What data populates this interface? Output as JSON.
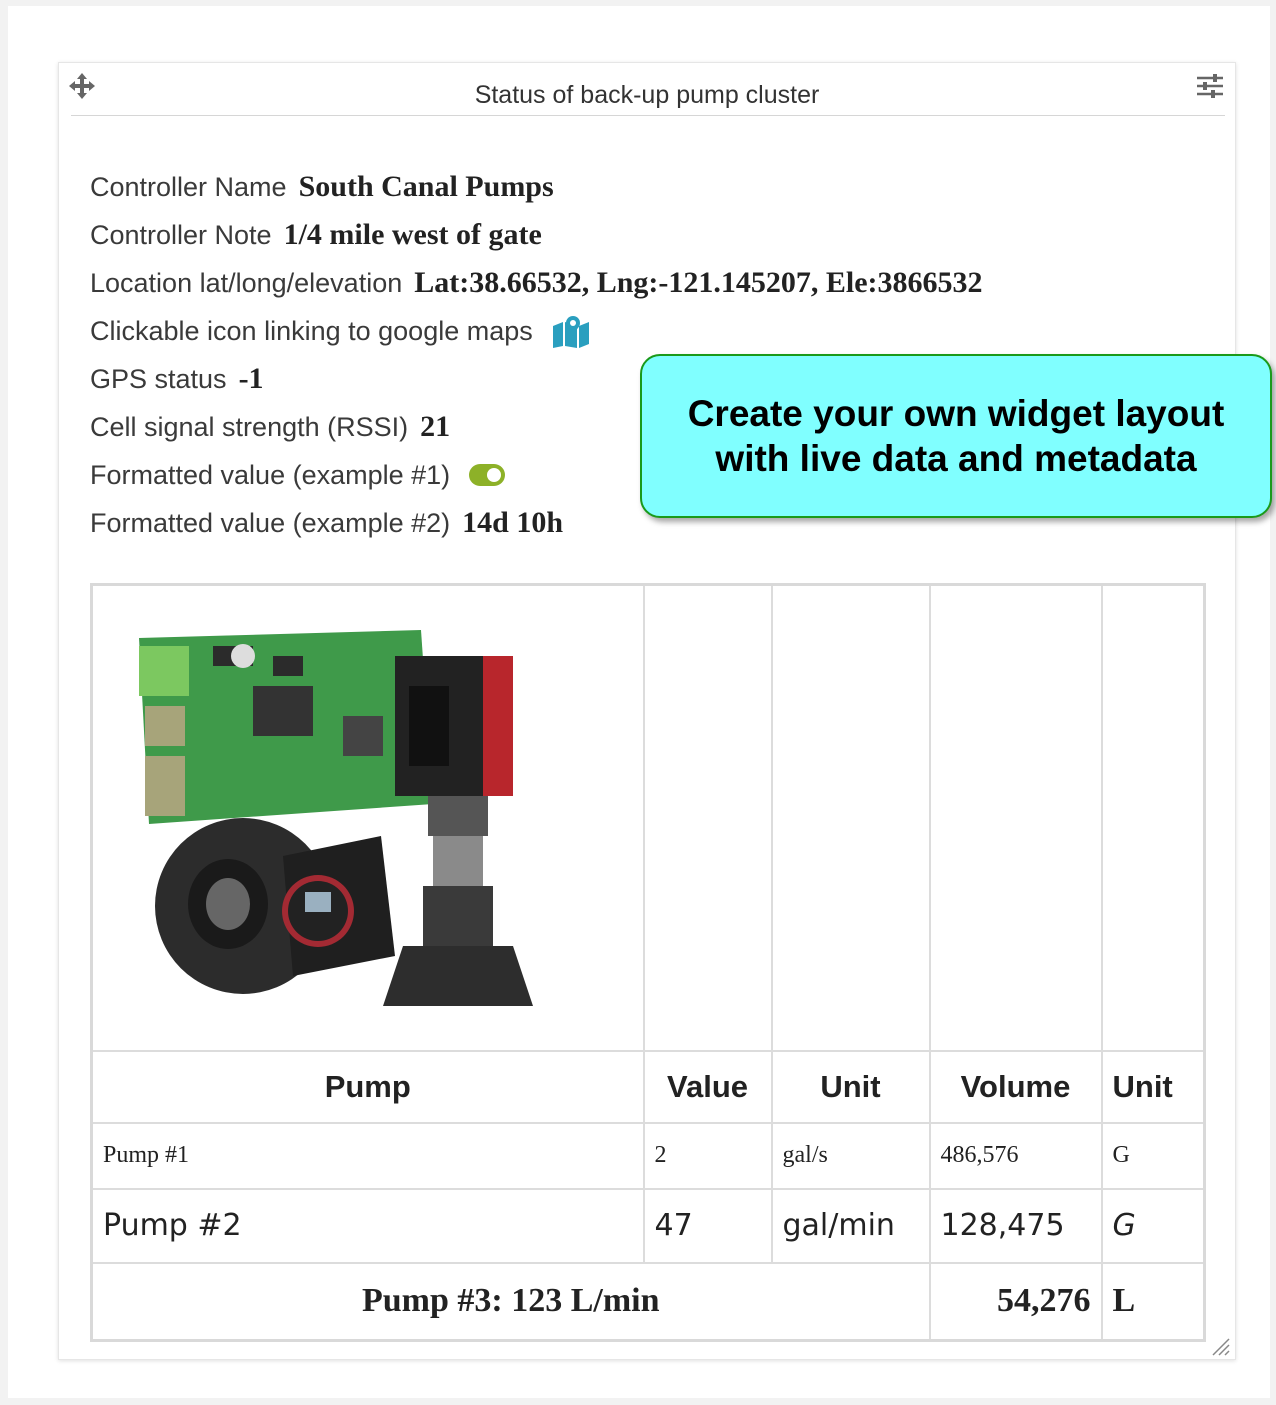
{
  "widget": {
    "title": "Status of back-up pump cluster"
  },
  "info": [
    {
      "label": "Controller Name",
      "value": "South Canal Pumps"
    },
    {
      "label": "Controller Note",
      "value": "1/4 mile west of gate"
    },
    {
      "label": "Location lat/long/elevation",
      "value": "Lat:38.66532, Lng:-121.145207, Ele:3866532"
    },
    {
      "label": "Clickable icon linking to google maps",
      "icon": "map-marker-icon"
    },
    {
      "label": "GPS status",
      "value": "-1"
    },
    {
      "label": "Cell signal strength (RSSI)",
      "value": "21"
    },
    {
      "label": "Formatted value (example #1)",
      "icon": "toggle-on-icon"
    },
    {
      "label": "Formatted value (example #2)",
      "value": "14d 10h"
    }
  ],
  "table": {
    "headers": [
      "Pump",
      "Value",
      "Unit",
      "Volume",
      "Unit"
    ],
    "rows": [
      {
        "pump": "Pump #1",
        "value": "2",
        "unit": "gal/s",
        "volume": "486,576",
        "vunit": "G"
      },
      {
        "pump": "Pump #2",
        "value": "47",
        "unit": "gal/min",
        "volume": "128,475",
        "vunit": "G"
      }
    ],
    "summary": {
      "text": "Pump #3: 123 L/min",
      "volume": "54,276",
      "vunit": "L"
    }
  },
  "callout": {
    "line1": "Create your own widget layout",
    "line2": "with live data and metadata"
  },
  "colors": {
    "callout_bg": "#80ffff",
    "callout_border": "#1a9a1a",
    "map_icon": "#2a9fbf",
    "toggle": "#8db128"
  }
}
